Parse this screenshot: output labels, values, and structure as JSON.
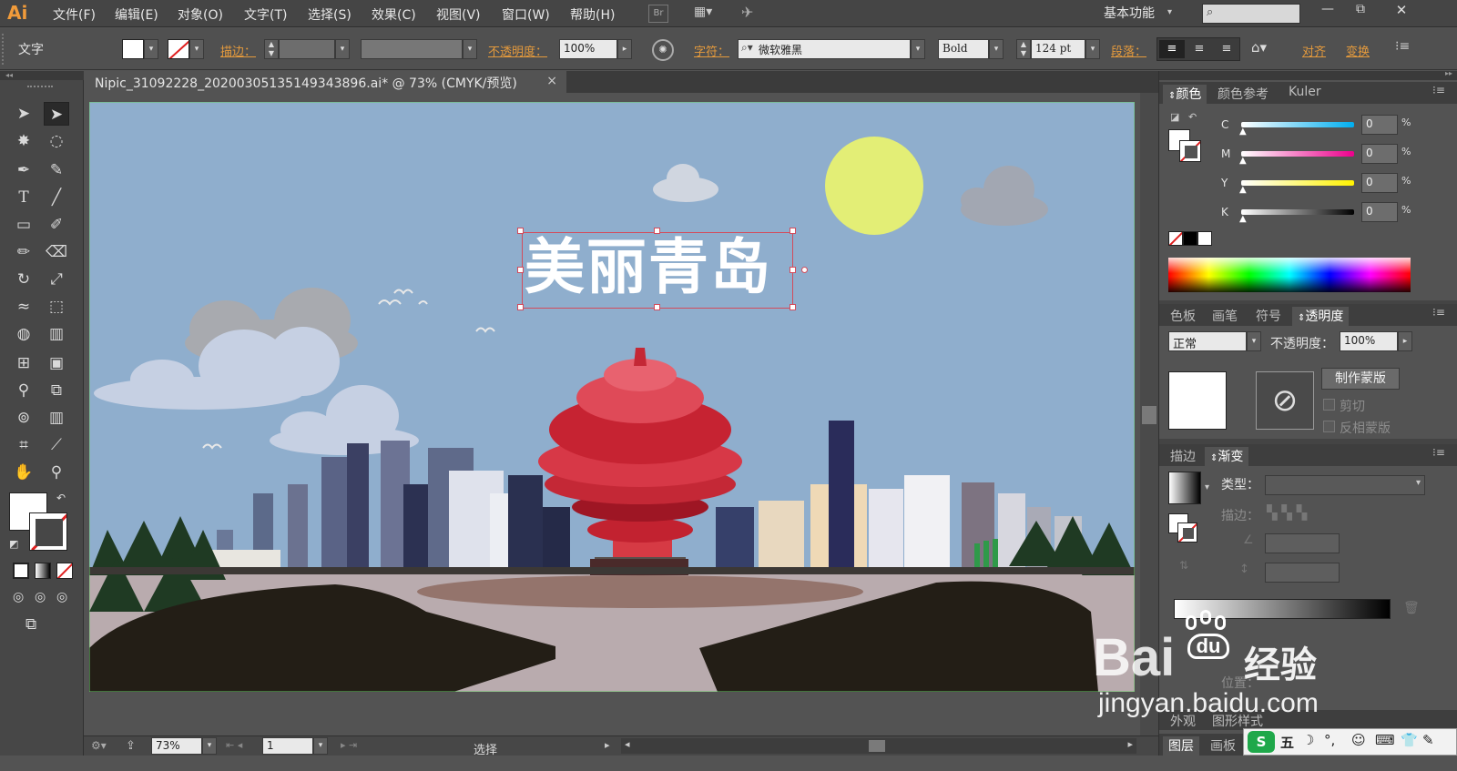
{
  "app": {
    "logo": "Ai"
  },
  "menu": {
    "items": [
      "文件(F)",
      "编辑(E)",
      "对象(O)",
      "文字(T)",
      "选择(S)",
      "效果(C)",
      "视图(V)",
      "窗口(W)",
      "帮助(H)"
    ],
    "br_label": "Br",
    "workspace": "基本功能",
    "window_controls": [
      "—",
      "⧉",
      "✕"
    ]
  },
  "control_bar": {
    "tool_name": "文字",
    "stroke_label": "描边：",
    "opacity_label": "不透明度：",
    "opacity_value": "100%",
    "char_label": "字符：",
    "font_name": "微软雅黑",
    "font_style": "Bold",
    "font_size": "124 pt",
    "para_label": "段落：",
    "align_label": "对齐",
    "transform_label": "变换"
  },
  "document": {
    "tab_title": "Nipic_31092228_20200305135149343896.ai* @ 73% (CMYK/预览)",
    "close": "×"
  },
  "artwork": {
    "headline": "美丽青岛"
  },
  "status": {
    "zoom": "73%",
    "page": "1",
    "mode": "选择"
  },
  "panels": {
    "color_tabs": [
      "颜色",
      "颜色参考",
      "Kuler"
    ],
    "cmyk": [
      {
        "label": "C",
        "value": "0",
        "color_from": "#ffffff",
        "color_to": "#00aeef"
      },
      {
        "label": "M",
        "value": "0",
        "color_from": "#ffffff",
        "color_to": "#ec008c"
      },
      {
        "label": "Y",
        "value": "0",
        "color_from": "#ffffff",
        "color_to": "#fff200"
      },
      {
        "label": "K",
        "value": "0",
        "color_from": "#ffffff",
        "color_to": "#000000"
      }
    ],
    "swatch_tabs": [
      "色板",
      "画笔",
      "符号",
      "透明度"
    ],
    "blend_mode": "正常",
    "opacity_label": "不透明度：",
    "opacity_value": "100%",
    "make_mask": "制作蒙版",
    "clip": "剪切",
    "invert_mask": "反相蒙版",
    "gradient_tabs": [
      "描边",
      "渐变"
    ],
    "type_label": "类型：",
    "stroke_label": "描边：",
    "location_label": "位置：",
    "bottom_tabs": [
      "外观",
      "图形样式"
    ],
    "layer_tabs": [
      "图层",
      "画板"
    ]
  },
  "watermark": {
    "brand": "Bai",
    "brand2": "du",
    "cn": "经验",
    "url": "jingyan.baidu.com"
  },
  "ime": {
    "label": "五"
  }
}
